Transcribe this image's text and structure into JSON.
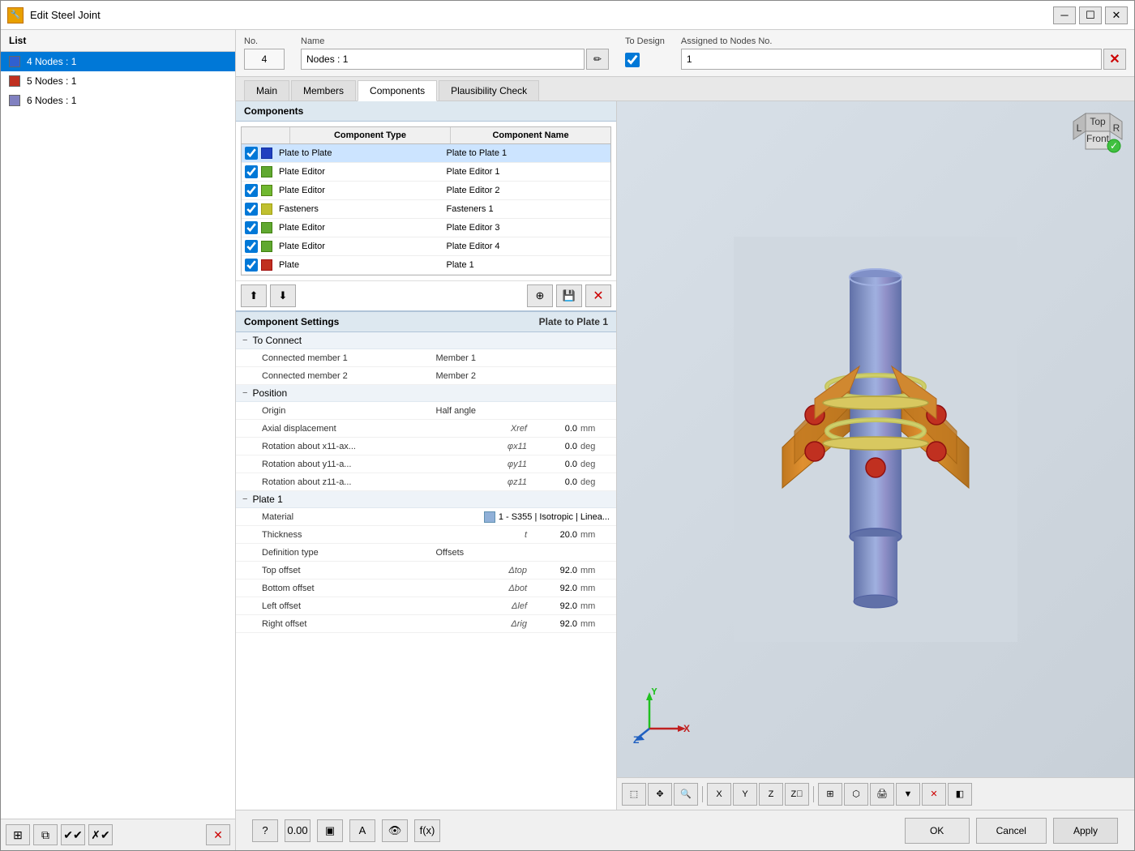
{
  "window": {
    "title": "Edit Steel Joint",
    "icon": "🔧"
  },
  "header": {
    "no_label": "No.",
    "no_value": "4",
    "name_label": "Name",
    "name_value": "Nodes : 1",
    "to_design_label": "To Design",
    "assigned_label": "Assigned to Nodes No.",
    "assigned_value": "1"
  },
  "tabs": {
    "items": [
      "Main",
      "Members",
      "Components",
      "Plausibility Check"
    ],
    "active": 2
  },
  "list": {
    "label": "List",
    "items": [
      {
        "id": 1,
        "color": "#3060d0",
        "text": "4  Nodes : 1",
        "selected": true
      },
      {
        "id": 2,
        "color": "#c03020",
        "text": "5  Nodes : 1",
        "selected": false
      },
      {
        "id": 3,
        "color": "#8080c0",
        "text": "6  Nodes : 1",
        "selected": false
      }
    ]
  },
  "components": {
    "title": "Components",
    "table_headers": [
      "Component Type",
      "Component Name"
    ],
    "rows": [
      {
        "checked": true,
        "color": "#2040c0",
        "type": "Plate to Plate",
        "name": "Plate to Plate 1",
        "selected": true
      },
      {
        "checked": true,
        "color": "#60a830",
        "type": "Plate Editor",
        "name": "Plate Editor 1",
        "selected": false
      },
      {
        "checked": true,
        "color": "#70b830",
        "type": "Plate Editor",
        "name": "Plate Editor 2",
        "selected": false
      },
      {
        "checked": true,
        "color": "#c0c030",
        "type": "Fasteners",
        "name": "Fasteners 1",
        "selected": false
      },
      {
        "checked": true,
        "color": "#60a830",
        "type": "Plate Editor",
        "name": "Plate Editor 3",
        "selected": false
      },
      {
        "checked": true,
        "color": "#60a830",
        "type": "Plate Editor",
        "name": "Plate Editor 4",
        "selected": false
      },
      {
        "checked": true,
        "color": "#c03020",
        "type": "Plate",
        "name": "Plate 1",
        "selected": false
      }
    ]
  },
  "component_settings": {
    "title": "Component Settings",
    "component_name": "Plate to Plate 1",
    "groups": [
      {
        "label": "To Connect",
        "collapsed": false,
        "properties": [
          {
            "label": "Connected member 1",
            "symbol": "",
            "value": "Member 1",
            "unit": "",
            "type": "text"
          },
          {
            "label": "Connected member 2",
            "symbol": "",
            "value": "Member 2",
            "unit": "",
            "type": "text"
          }
        ]
      },
      {
        "label": "Position",
        "collapsed": false,
        "properties": [
          {
            "label": "Origin",
            "symbol": "",
            "value": "Half angle",
            "unit": "",
            "type": "text"
          },
          {
            "label": "Axial displacement",
            "symbol": "Xref",
            "value": "0.0",
            "unit": "mm",
            "type": "number"
          },
          {
            "label": "Rotation about x11-ax...",
            "symbol": "φx11",
            "value": "0.0",
            "unit": "deg",
            "type": "number"
          },
          {
            "label": "Rotation about y11-a...",
            "symbol": "φy11",
            "value": "0.0",
            "unit": "deg",
            "type": "number"
          },
          {
            "label": "Rotation about z11-a...",
            "symbol": "φz11",
            "value": "0.0",
            "unit": "deg",
            "type": "number"
          }
        ]
      },
      {
        "label": "Plate 1",
        "collapsed": false,
        "properties": [
          {
            "label": "Material",
            "symbol": "",
            "value": "1 - S355 | Isotropic | Linea...",
            "unit": "",
            "type": "material"
          },
          {
            "label": "Thickness",
            "symbol": "t",
            "value": "20.0",
            "unit": "mm",
            "type": "number"
          },
          {
            "label": "Definition type",
            "symbol": "",
            "value": "Offsets",
            "unit": "",
            "type": "text"
          },
          {
            "label": "Top offset",
            "symbol": "Δtop",
            "value": "92.0",
            "unit": "mm",
            "type": "number"
          },
          {
            "label": "Bottom offset",
            "symbol": "Δbot",
            "value": "92.0",
            "unit": "mm",
            "type": "number"
          },
          {
            "label": "Left offset",
            "symbol": "Δlef",
            "value": "92.0",
            "unit": "mm",
            "type": "number"
          },
          {
            "label": "Right offset",
            "symbol": "Δrig",
            "value": "92.0",
            "unit": "mm",
            "type": "number"
          }
        ]
      }
    ]
  },
  "dialog_buttons": {
    "ok": "OK",
    "cancel": "Cancel",
    "apply": "Apply"
  },
  "footer_icons": [
    "?",
    "0.00",
    "▣",
    "A",
    "👁",
    "f(x)"
  ]
}
